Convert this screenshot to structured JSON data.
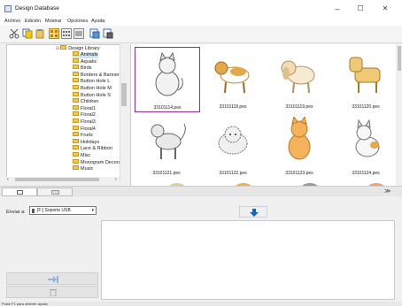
{
  "window": {
    "title": "Design Database",
    "minimize": "–",
    "maximize": "☐",
    "close": "✕"
  },
  "menu": [
    "Archivo",
    "Edición",
    "Mostrar",
    "Opciones",
    "Ayuda"
  ],
  "toolbar": {
    "icons": [
      "cut-icon",
      "copy-icon",
      "paste-icon",
      "large-thumbs-icon",
      "medium-thumbs-icon",
      "list-view-icon",
      "import-icon",
      "export-icon"
    ]
  },
  "tree": {
    "root": "Design Library",
    "items": [
      "Animals",
      "Aquatic",
      "Birds",
      "Borders & Banners",
      "Button Hole L",
      "Button Hole M",
      "Button Hole S",
      "Children",
      "Floral1",
      "Floral2",
      "Floral3",
      "Floral4",
      "Fruits",
      "Holidays",
      "Lace & Ribbon",
      "Misc",
      "Monogram Decorati",
      "Music"
    ],
    "selected_index": 0
  },
  "designs": [
    {
      "file": "33101114.pes",
      "animal": "cat-sitting",
      "selected": true
    },
    {
      "file": "33101118.pes",
      "animal": "dog-beagle"
    },
    {
      "file": "33101119.pes",
      "animal": "dog-spaniel"
    },
    {
      "file": "33101120.pes",
      "animal": "dog-terrier"
    },
    {
      "file": "33101121.pes",
      "animal": "cat-standing"
    },
    {
      "file": "33101122.pes",
      "animal": "cat-persian"
    },
    {
      "file": "33101123.pes",
      "animal": "cat-orange"
    },
    {
      "file": "33101124.pes",
      "animal": "cat-kitten"
    }
  ],
  "send": {
    "label": "Enviar a:",
    "device": "[F:] Soporte USB"
  },
  "status": "Pulse F1 para obtener ayuda",
  "colors": {
    "selection": "#9b2d8a",
    "folder": "#f0c850",
    "send_arrow": "#1565c0",
    "send_arrow_disabled": "#8fb3d9"
  }
}
